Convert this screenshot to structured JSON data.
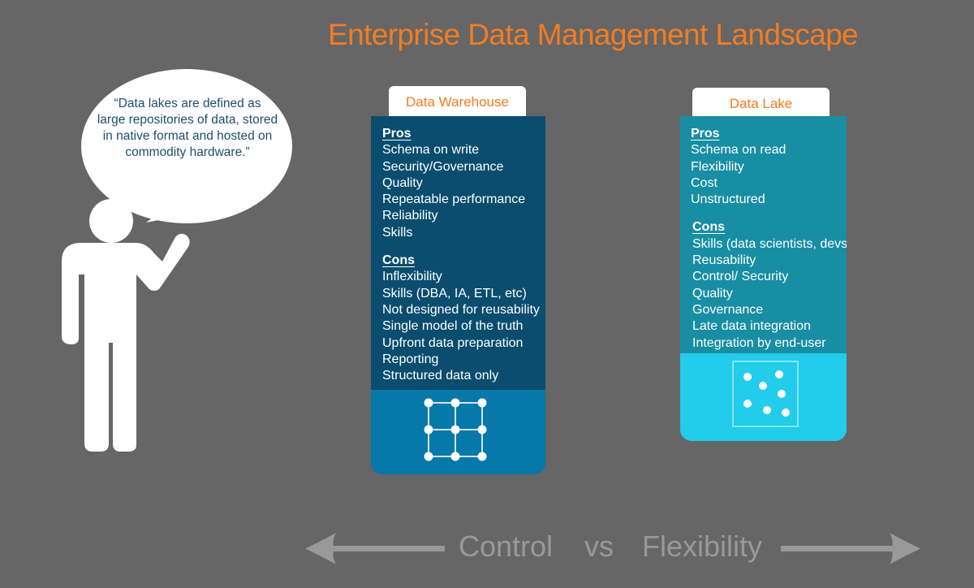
{
  "title": "Enterprise Data Management Landscape",
  "speech_bubble": {
    "quote_lines": [
      "“Data lakes are defined as",
      "large repositories of data, stored",
      "in native format and hosted on",
      "commodity hardware.”"
    ]
  },
  "colors": {
    "background": "#666666",
    "title": "#F47C20",
    "warehouse_body": "#0A4D6E",
    "warehouse_footer": "#0778AA",
    "lake_body": "#178EA3",
    "lake_footer": "#22CCEA",
    "quote_text": "#1F4E6E",
    "axis": "#999999"
  },
  "data_warehouse": {
    "label": "Data Warehouse",
    "pros_header": "Pros",
    "pros": [
      "Schema on write",
      "Security/Governance",
      "Quality",
      "Repeatable performance",
      "Reliability",
      "Skills"
    ],
    "cons_header": "Cons",
    "cons": [
      "Inflexibility",
      "Skills (DBA, IA, ETL, etc)",
      "Not designed for reusability",
      "Single model of the truth",
      "Upfront data preparation",
      "Reporting",
      "Structured data only"
    ],
    "icon": "structured-grid-icon"
  },
  "data_lake": {
    "label": "Data Lake",
    "pros_header": "Pros",
    "pros": [
      "Schema on read",
      "Flexibility",
      "Cost",
      "Unstructured"
    ],
    "cons_header": "Cons",
    "cons": [
      "Skills (data scientists, devs)",
      "Reusability",
      "Control/ Security",
      "Quality",
      "Governance",
      "Late data integration",
      "Integration by end-user"
    ],
    "icon": "scattered-dots-icon"
  },
  "axis": {
    "left_label": "Control",
    "middle_label": "vs",
    "right_label": "Flexibility"
  }
}
